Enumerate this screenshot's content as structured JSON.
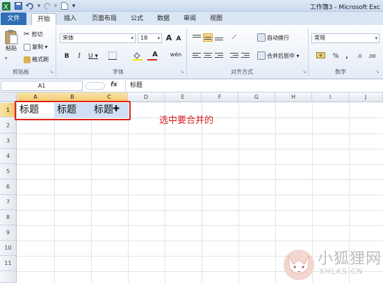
{
  "window": {
    "title": "工作簿3 - Microsoft Exc"
  },
  "quick_access": {
    "save_icon": "save-icon",
    "undo_icon": "undo-icon",
    "redo_icon": "redo-icon",
    "new_icon": "new-doc-icon",
    "more": "▾"
  },
  "tabs": [
    {
      "label": "文件"
    },
    {
      "label": "开始"
    },
    {
      "label": "插入"
    },
    {
      "label": "页面布局"
    },
    {
      "label": "公式"
    },
    {
      "label": "数据"
    },
    {
      "label": "审阅"
    },
    {
      "label": "视图"
    }
  ],
  "ribbon": {
    "clipboard": {
      "label": "剪贴板",
      "paste": "粘贴",
      "cut": "剪切",
      "copy": "复制 ▾",
      "format_painter": "格式刷"
    },
    "font": {
      "label": "字体",
      "font_name": "宋体",
      "font_size": "18",
      "grow": "A",
      "shrink": "A",
      "bold": "B",
      "italic": "I",
      "underline": "U ▾",
      "wen": "wén",
      "font_color_letter": "A"
    },
    "alignment": {
      "label": "对齐方式",
      "wrap_text": "自动换行",
      "merge_center": "合并后居中 ▾"
    },
    "number": {
      "label": "数字",
      "format": "常规",
      "percent": "%",
      "comma": ","
    }
  },
  "formula_bar": {
    "name_box": "A1",
    "fx": "fx",
    "value": "标题"
  },
  "columns": [
    "A",
    "B",
    "C",
    "D",
    "E",
    "F",
    "G",
    "H",
    "I",
    "J"
  ],
  "rows": [
    "1",
    "2",
    "3",
    "4",
    "5",
    "6",
    "7",
    "8",
    "9",
    "10",
    "11"
  ],
  "cells": {
    "A1": "标题",
    "B1": "标题",
    "C1": "标题"
  },
  "annotation": "选中要合并的",
  "watermark": {
    "cn": "小狐狸网",
    "en": "XHLKS.CN"
  },
  "colors": {
    "accent": "#2f6fb6",
    "selection": "#cfe0f4",
    "header_selected": "#f1c96a",
    "annotation": "#e0201b"
  }
}
